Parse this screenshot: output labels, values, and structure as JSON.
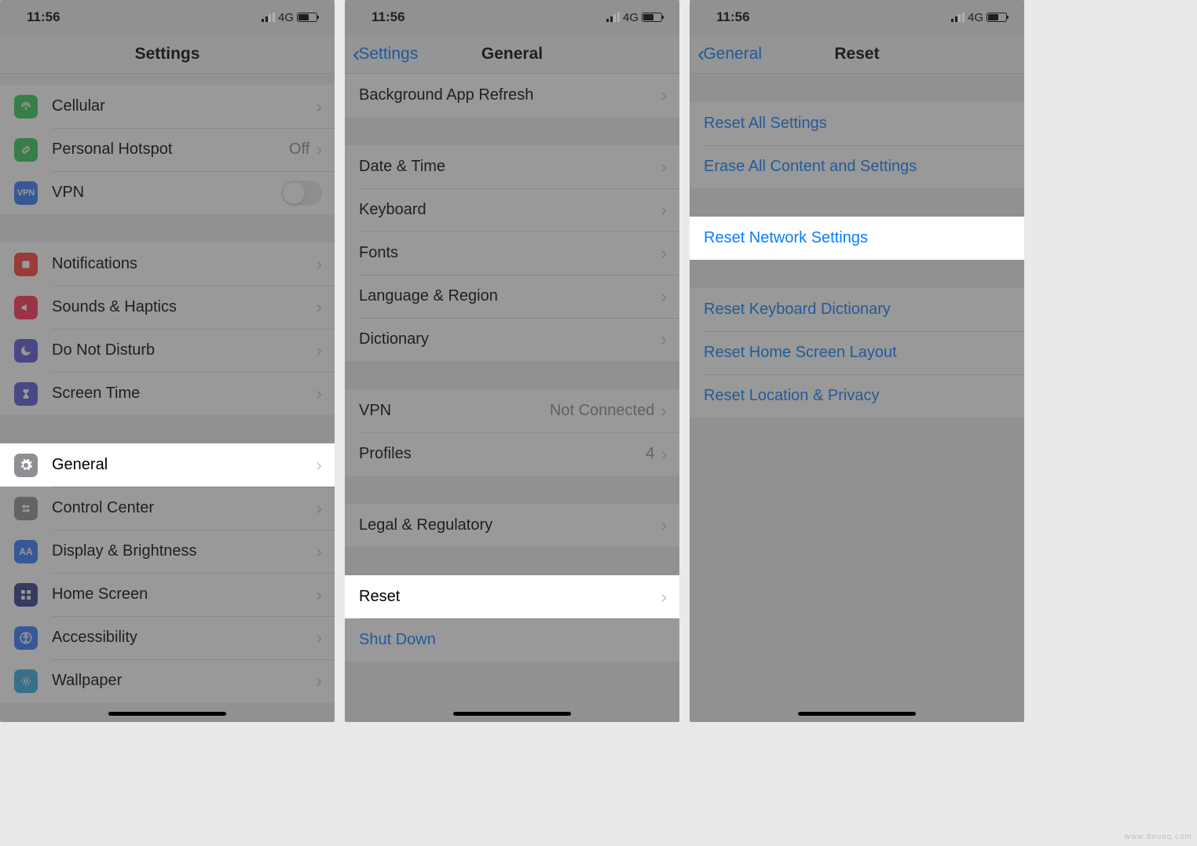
{
  "status": {
    "time": "11:56",
    "net": "4G"
  },
  "phone1": {
    "title": "Settings",
    "rows": {
      "cellular": "Cellular",
      "hotspot": "Personal Hotspot",
      "hotspot_value": "Off",
      "vpn": "VPN",
      "notifications": "Notifications",
      "sounds": "Sounds & Haptics",
      "dnd": "Do Not Disturb",
      "screentime": "Screen Time",
      "general": "General",
      "control": "Control Center",
      "display": "Display & Brightness",
      "home": "Home Screen",
      "access": "Accessibility",
      "wallpaper": "Wallpaper"
    }
  },
  "phone2": {
    "back": "Settings",
    "title": "General",
    "rows": {
      "bgapp": "Background App Refresh",
      "datetime": "Date & Time",
      "keyboard": "Keyboard",
      "fonts": "Fonts",
      "lang": "Language & Region",
      "dictionary": "Dictionary",
      "vpn": "VPN",
      "vpn_value": "Not Connected",
      "profiles": "Profiles",
      "profiles_value": "4",
      "legal": "Legal & Regulatory",
      "reset": "Reset",
      "shutdown": "Shut Down"
    }
  },
  "phone3": {
    "back": "General",
    "title": "Reset",
    "rows": {
      "all": "Reset All Settings",
      "erase": "Erase All Content and Settings",
      "network": "Reset Network Settings",
      "keyboard": "Reset Keyboard Dictionary",
      "homelayout": "Reset Home Screen Layout",
      "location": "Reset Location & Privacy"
    }
  },
  "watermark": "www.deuaq.com"
}
